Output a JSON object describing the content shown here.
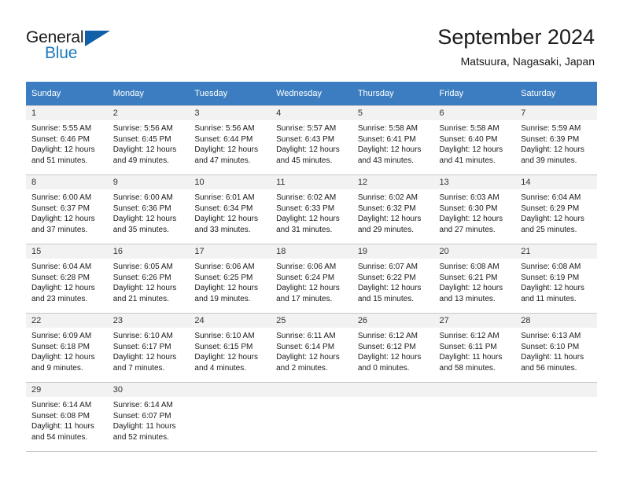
{
  "brand": {
    "general": "General",
    "blue": "Blue",
    "triangle_color": "#1060a8",
    "blue_color": "#1f7ac0"
  },
  "header": {
    "title": "September 2024",
    "subtitle": "Matsuura, Nagasaki, Japan"
  },
  "theme": {
    "header_row_bg": "#3b7dc0",
    "daynum_bg": "#f2f2f2",
    "border": "#c8c8c8"
  },
  "weekdays": [
    "Sunday",
    "Monday",
    "Tuesday",
    "Wednesday",
    "Thursday",
    "Friday",
    "Saturday"
  ],
  "weeks": [
    [
      {
        "day": "1",
        "sunrise": "Sunrise: 5:55 AM",
        "sunset": "Sunset: 6:46 PM",
        "daylight1": "Daylight: 12 hours",
        "daylight2": "and 51 minutes."
      },
      {
        "day": "2",
        "sunrise": "Sunrise: 5:56 AM",
        "sunset": "Sunset: 6:45 PM",
        "daylight1": "Daylight: 12 hours",
        "daylight2": "and 49 minutes."
      },
      {
        "day": "3",
        "sunrise": "Sunrise: 5:56 AM",
        "sunset": "Sunset: 6:44 PM",
        "daylight1": "Daylight: 12 hours",
        "daylight2": "and 47 minutes."
      },
      {
        "day": "4",
        "sunrise": "Sunrise: 5:57 AM",
        "sunset": "Sunset: 6:43 PM",
        "daylight1": "Daylight: 12 hours",
        "daylight2": "and 45 minutes."
      },
      {
        "day": "5",
        "sunrise": "Sunrise: 5:58 AM",
        "sunset": "Sunset: 6:41 PM",
        "daylight1": "Daylight: 12 hours",
        "daylight2": "and 43 minutes."
      },
      {
        "day": "6",
        "sunrise": "Sunrise: 5:58 AM",
        "sunset": "Sunset: 6:40 PM",
        "daylight1": "Daylight: 12 hours",
        "daylight2": "and 41 minutes."
      },
      {
        "day": "7",
        "sunrise": "Sunrise: 5:59 AM",
        "sunset": "Sunset: 6:39 PM",
        "daylight1": "Daylight: 12 hours",
        "daylight2": "and 39 minutes."
      }
    ],
    [
      {
        "day": "8",
        "sunrise": "Sunrise: 6:00 AM",
        "sunset": "Sunset: 6:37 PM",
        "daylight1": "Daylight: 12 hours",
        "daylight2": "and 37 minutes."
      },
      {
        "day": "9",
        "sunrise": "Sunrise: 6:00 AM",
        "sunset": "Sunset: 6:36 PM",
        "daylight1": "Daylight: 12 hours",
        "daylight2": "and 35 minutes."
      },
      {
        "day": "10",
        "sunrise": "Sunrise: 6:01 AM",
        "sunset": "Sunset: 6:34 PM",
        "daylight1": "Daylight: 12 hours",
        "daylight2": "and 33 minutes."
      },
      {
        "day": "11",
        "sunrise": "Sunrise: 6:02 AM",
        "sunset": "Sunset: 6:33 PM",
        "daylight1": "Daylight: 12 hours",
        "daylight2": "and 31 minutes."
      },
      {
        "day": "12",
        "sunrise": "Sunrise: 6:02 AM",
        "sunset": "Sunset: 6:32 PM",
        "daylight1": "Daylight: 12 hours",
        "daylight2": "and 29 minutes."
      },
      {
        "day": "13",
        "sunrise": "Sunrise: 6:03 AM",
        "sunset": "Sunset: 6:30 PM",
        "daylight1": "Daylight: 12 hours",
        "daylight2": "and 27 minutes."
      },
      {
        "day": "14",
        "sunrise": "Sunrise: 6:04 AM",
        "sunset": "Sunset: 6:29 PM",
        "daylight1": "Daylight: 12 hours",
        "daylight2": "and 25 minutes."
      }
    ],
    [
      {
        "day": "15",
        "sunrise": "Sunrise: 6:04 AM",
        "sunset": "Sunset: 6:28 PM",
        "daylight1": "Daylight: 12 hours",
        "daylight2": "and 23 minutes."
      },
      {
        "day": "16",
        "sunrise": "Sunrise: 6:05 AM",
        "sunset": "Sunset: 6:26 PM",
        "daylight1": "Daylight: 12 hours",
        "daylight2": "and 21 minutes."
      },
      {
        "day": "17",
        "sunrise": "Sunrise: 6:06 AM",
        "sunset": "Sunset: 6:25 PM",
        "daylight1": "Daylight: 12 hours",
        "daylight2": "and 19 minutes."
      },
      {
        "day": "18",
        "sunrise": "Sunrise: 6:06 AM",
        "sunset": "Sunset: 6:24 PM",
        "daylight1": "Daylight: 12 hours",
        "daylight2": "and 17 minutes."
      },
      {
        "day": "19",
        "sunrise": "Sunrise: 6:07 AM",
        "sunset": "Sunset: 6:22 PM",
        "daylight1": "Daylight: 12 hours",
        "daylight2": "and 15 minutes."
      },
      {
        "day": "20",
        "sunrise": "Sunrise: 6:08 AM",
        "sunset": "Sunset: 6:21 PM",
        "daylight1": "Daylight: 12 hours",
        "daylight2": "and 13 minutes."
      },
      {
        "day": "21",
        "sunrise": "Sunrise: 6:08 AM",
        "sunset": "Sunset: 6:19 PM",
        "daylight1": "Daylight: 12 hours",
        "daylight2": "and 11 minutes."
      }
    ],
    [
      {
        "day": "22",
        "sunrise": "Sunrise: 6:09 AM",
        "sunset": "Sunset: 6:18 PM",
        "daylight1": "Daylight: 12 hours",
        "daylight2": "and 9 minutes."
      },
      {
        "day": "23",
        "sunrise": "Sunrise: 6:10 AM",
        "sunset": "Sunset: 6:17 PM",
        "daylight1": "Daylight: 12 hours",
        "daylight2": "and 7 minutes."
      },
      {
        "day": "24",
        "sunrise": "Sunrise: 6:10 AM",
        "sunset": "Sunset: 6:15 PM",
        "daylight1": "Daylight: 12 hours",
        "daylight2": "and 4 minutes."
      },
      {
        "day": "25",
        "sunrise": "Sunrise: 6:11 AM",
        "sunset": "Sunset: 6:14 PM",
        "daylight1": "Daylight: 12 hours",
        "daylight2": "and 2 minutes."
      },
      {
        "day": "26",
        "sunrise": "Sunrise: 6:12 AM",
        "sunset": "Sunset: 6:12 PM",
        "daylight1": "Daylight: 12 hours",
        "daylight2": "and 0 minutes."
      },
      {
        "day": "27",
        "sunrise": "Sunrise: 6:12 AM",
        "sunset": "Sunset: 6:11 PM",
        "daylight1": "Daylight: 11 hours",
        "daylight2": "and 58 minutes."
      },
      {
        "day": "28",
        "sunrise": "Sunrise: 6:13 AM",
        "sunset": "Sunset: 6:10 PM",
        "daylight1": "Daylight: 11 hours",
        "daylight2": "and 56 minutes."
      }
    ],
    [
      {
        "day": "29",
        "sunrise": "Sunrise: 6:14 AM",
        "sunset": "Sunset: 6:08 PM",
        "daylight1": "Daylight: 11 hours",
        "daylight2": "and 54 minutes."
      },
      {
        "day": "30",
        "sunrise": "Sunrise: 6:14 AM",
        "sunset": "Sunset: 6:07 PM",
        "daylight1": "Daylight: 11 hours",
        "daylight2": "and 52 minutes."
      },
      {
        "day": "",
        "sunrise": "",
        "sunset": "",
        "daylight1": "",
        "daylight2": ""
      },
      {
        "day": "",
        "sunrise": "",
        "sunset": "",
        "daylight1": "",
        "daylight2": ""
      },
      {
        "day": "",
        "sunrise": "",
        "sunset": "",
        "daylight1": "",
        "daylight2": ""
      },
      {
        "day": "",
        "sunrise": "",
        "sunset": "",
        "daylight1": "",
        "daylight2": ""
      },
      {
        "day": "",
        "sunrise": "",
        "sunset": "",
        "daylight1": "",
        "daylight2": ""
      }
    ]
  ]
}
